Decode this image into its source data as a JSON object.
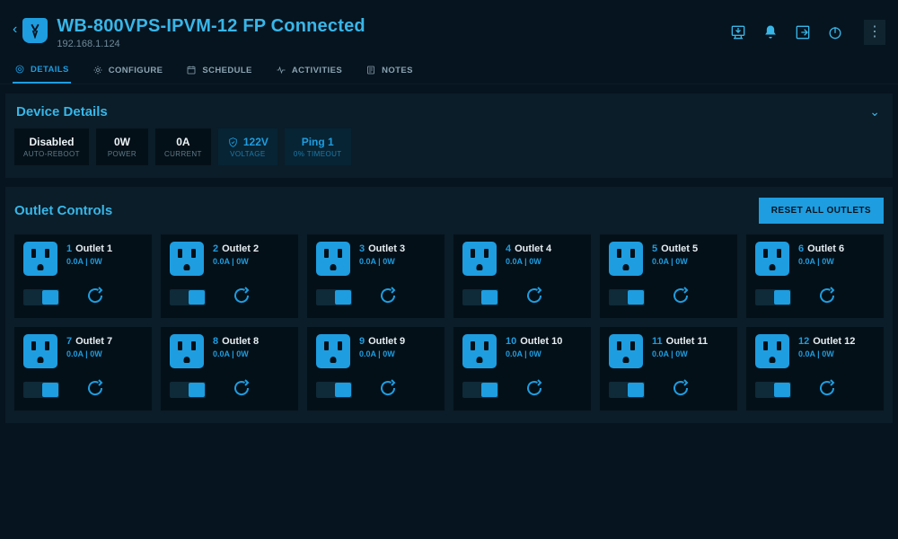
{
  "header": {
    "title": "WB-800VPS-IPVM-12 FP Connected",
    "ip": "192.168.1.124"
  },
  "tabs": {
    "details": "DETAILS",
    "configure": "CONFIGURE",
    "schedule": "SCHEDULE",
    "activities": "ACTIVITIES",
    "notes": "NOTES"
  },
  "device_panel": {
    "title": "Device Details",
    "auto_reboot": {
      "value": "Disabled",
      "label": "AUTO-REBOOT"
    },
    "power": {
      "value": "0W",
      "label": "POWER"
    },
    "current": {
      "value": "0A",
      "label": "CURRENT"
    },
    "voltage": {
      "value": "122V",
      "label": "VOLTAGE"
    },
    "ping": {
      "value": "Ping 1",
      "label": "0% TIMEOUT"
    }
  },
  "outlets_panel": {
    "title": "Outlet Controls",
    "reset_label": "RESET ALL OUTLETS"
  },
  "outlets": [
    {
      "num": "1",
      "name": "Outlet 1",
      "stats": "0.0A | 0W"
    },
    {
      "num": "2",
      "name": "Outlet 2",
      "stats": "0.0A | 0W"
    },
    {
      "num": "3",
      "name": "Outlet 3",
      "stats": "0.0A | 0W"
    },
    {
      "num": "4",
      "name": "Outlet 4",
      "stats": "0.0A | 0W"
    },
    {
      "num": "5",
      "name": "Outlet 5",
      "stats": "0.0A | 0W"
    },
    {
      "num": "6",
      "name": "Outlet 6",
      "stats": "0.0A | 0W"
    },
    {
      "num": "7",
      "name": "Outlet 7",
      "stats": "0.0A | 0W"
    },
    {
      "num": "8",
      "name": "Outlet 8",
      "stats": "0.0A | 0W"
    },
    {
      "num": "9",
      "name": "Outlet 9",
      "stats": "0.0A | 0W"
    },
    {
      "num": "10",
      "name": "Outlet 10",
      "stats": "0.0A | 0W"
    },
    {
      "num": "11",
      "name": "Outlet 11",
      "stats": "0.0A | 0W"
    },
    {
      "num": "12",
      "name": "Outlet 12",
      "stats": "0.0A | 0W"
    }
  ]
}
